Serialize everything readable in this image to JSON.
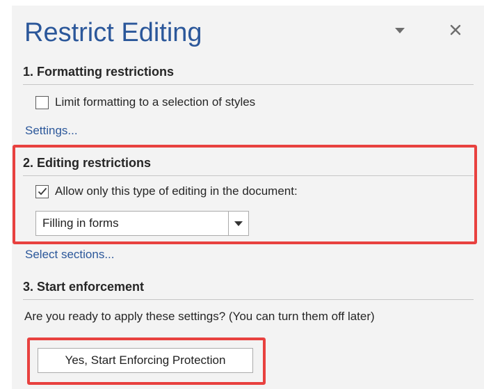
{
  "pane": {
    "title": "Restrict Editing",
    "menu_icon": "chevron-down-icon",
    "close_icon": "close-icon"
  },
  "formatting": {
    "heading": "1. Formatting restrictions",
    "checkbox_label": "Limit formatting to a selection of styles",
    "checked": false,
    "settings_link": "Settings..."
  },
  "editing": {
    "heading": "2. Editing restrictions",
    "checkbox_label": "Allow only this type of editing in the document:",
    "checked": true,
    "dropdown_value": "Filling in forms",
    "select_sections_link": "Select sections..."
  },
  "enforcement": {
    "heading": "3. Start enforcement",
    "prompt": "Are you ready to apply these settings? (You can turn them off later)",
    "button_label": "Yes, Start Enforcing Protection"
  },
  "colors": {
    "title_blue": "#2b579a",
    "highlight_red": "#e8413f",
    "pane_bg": "#f3f3f3"
  }
}
